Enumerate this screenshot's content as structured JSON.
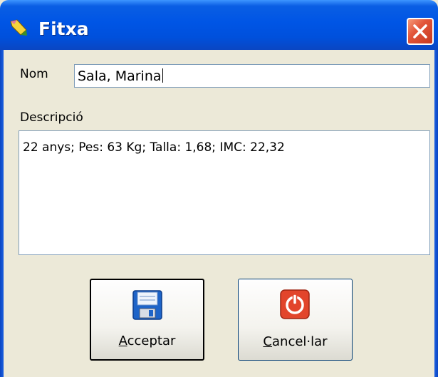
{
  "window": {
    "title": "Fitxa"
  },
  "icons": {
    "title": "pencil-icon",
    "close": "close-icon",
    "accept": "floppy-disk-icon",
    "cancel": "power-icon"
  },
  "form": {
    "name_label": "Nom",
    "name_value": "Sala, Marina",
    "description_label": "Descripció",
    "description_value": "22 anys; Pes: 63 Kg; Talla: 1,68; IMC: 22,32"
  },
  "buttons": {
    "accept_first": "A",
    "accept_rest": "cceptar",
    "cancel_first": "C",
    "cancel_rest": "ancel·lar"
  },
  "colors": {
    "titlebar": "#0055e5",
    "close": "#e2553a",
    "dialog": "#ece9d8"
  }
}
